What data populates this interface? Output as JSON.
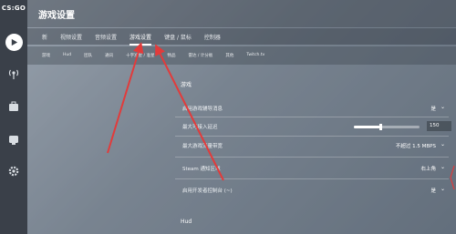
{
  "app": {
    "logo_text": "CS:GO",
    "title": "游戏设置"
  },
  "tabs": [
    {
      "label": "新"
    },
    {
      "label": "视频设置"
    },
    {
      "label": "音频设置"
    },
    {
      "label": "游戏设置"
    },
    {
      "label": "键盘 / 鼠标"
    },
    {
      "label": "控制器"
    }
  ],
  "subtabs": [
    {
      "label": "游戏"
    },
    {
      "label": "Hud"
    },
    {
      "label": "团队"
    },
    {
      "label": "通讯"
    },
    {
      "label": "十字准星 / 准星"
    },
    {
      "label": "物品"
    },
    {
      "label": "雷达 / 计分板"
    },
    {
      "label": "其他"
    },
    {
      "label": "Twitch.tv"
    }
  ],
  "sections": {
    "game": "游戏",
    "hud": "Hud"
  },
  "settings": [
    {
      "label": "启用游戏辅导消息",
      "value": "是"
    },
    {
      "label": "最大可接入延迟",
      "value": "150",
      "slider_fraction": 0.4
    },
    {
      "label": "最大游戏流量带宽",
      "value": "不超过 1.5 MBPS"
    },
    {
      "label": "Steam 通知区域",
      "value": "右上角"
    },
    {
      "label": "启用开发者控制台 (~)",
      "value": "是"
    }
  ],
  "colors": {
    "annotation_arrow": "#e23b3b",
    "sidebar": "#3a4049"
  }
}
